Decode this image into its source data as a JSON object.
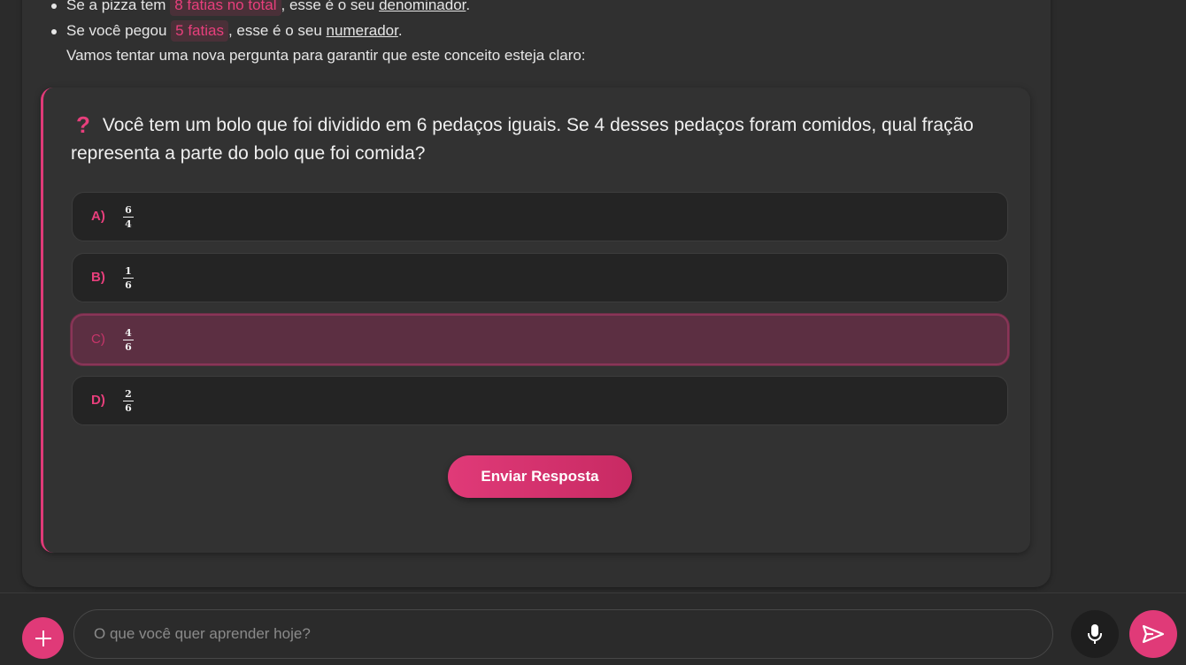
{
  "explanation": {
    "bullet1": {
      "prefix": "Se a pizza tem",
      "highlight": "8 fatias no total",
      "middle": ", esse é o seu",
      "term": "denominador",
      "suffix": "."
    },
    "bullet2": {
      "prefix": "Se você pegou",
      "highlight": "5 fatias",
      "middle": ", esse é o seu",
      "term": "numerador",
      "suffix": "."
    },
    "intro": "Vamos tentar uma nova pergunta para garantir que este conceito esteja claro:"
  },
  "question": {
    "icon": "question-mark-icon",
    "text": "Você tem um bolo que foi dividido em 6 pedaços iguais. Se 4 desses pedaços foram comidos, qual fração representa a parte do bolo que foi comida?",
    "options": [
      {
        "letter": "A)",
        "numerator": "6",
        "denominator": "4"
      },
      {
        "letter": "B)",
        "numerator": "1",
        "denominator": "6"
      },
      {
        "letter": "C)",
        "numerator": "4",
        "denominator": "6"
      },
      {
        "letter": "D)",
        "numerator": "2",
        "denominator": "6"
      }
    ],
    "selected_option": "C)",
    "submit_label": "Enviar Resposta"
  },
  "composer": {
    "placeholder": "O que você quer aprender hoje?",
    "add_icon": "plus-icon",
    "mic_icon": "microphone-icon",
    "send_icon": "send-icon"
  },
  "colors": {
    "accent": "#e03a78",
    "selected_bg": "#5c2f42",
    "background": "#2a2a2a"
  }
}
